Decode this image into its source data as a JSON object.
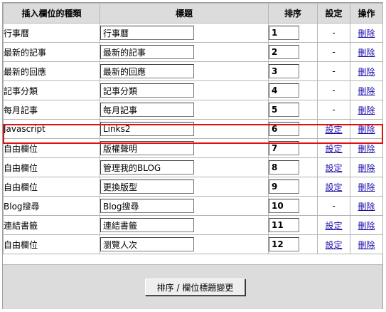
{
  "headers": {
    "type": "插入欄位的種類",
    "title": "標題",
    "order": "排序",
    "settings": "設定",
    "action": "操作"
  },
  "rows": [
    {
      "type": "行事曆",
      "title": "行事曆",
      "order": "1",
      "settings": "-",
      "delete": "刪除"
    },
    {
      "type": "最新的記事",
      "title": "最新的記事",
      "order": "2",
      "settings": "-",
      "delete": "刪除"
    },
    {
      "type": "最新的回應",
      "title": "最新的回應",
      "order": "3",
      "settings": "-",
      "delete": "刪除"
    },
    {
      "type": "記事分類",
      "title": "記事分類",
      "order": "4",
      "settings": "-",
      "delete": "刪除"
    },
    {
      "type": "每月記事",
      "title": "每月記事",
      "order": "5",
      "settings": "-",
      "delete": "刪除"
    },
    {
      "type": "Javascript",
      "title": "Links2",
      "order": "6",
      "settings": "設定",
      "delete": "刪除"
    },
    {
      "type": "自由欄位",
      "title": "版權聲明",
      "order": "7",
      "settings": "設定",
      "delete": "刪除"
    },
    {
      "type": "自由欄位",
      "title": "管理我的BLOG",
      "order": "8",
      "settings": "設定",
      "delete": "刪除"
    },
    {
      "type": "自由欄位",
      "title": "更換版型",
      "order": "9",
      "settings": "設定",
      "delete": "刪除"
    },
    {
      "type": "Blog搜尋",
      "title": "Blog搜尋",
      "order": "10",
      "settings": "-",
      "delete": "刪除"
    },
    {
      "type": "連結書籤",
      "title": "連結書籤",
      "order": "11",
      "settings": "設定",
      "delete": "刪除"
    },
    {
      "type": "自由欄位",
      "title": "瀏覽人次",
      "order": "12",
      "settings": "設定",
      "delete": "刪除"
    }
  ],
  "submit_label": "排序 / 欄位標題變更",
  "colors": {
    "header_bg": "#dcdcdc",
    "link": "#1a0dab",
    "highlight": "#e01010",
    "border": "#b4b4b4"
  }
}
